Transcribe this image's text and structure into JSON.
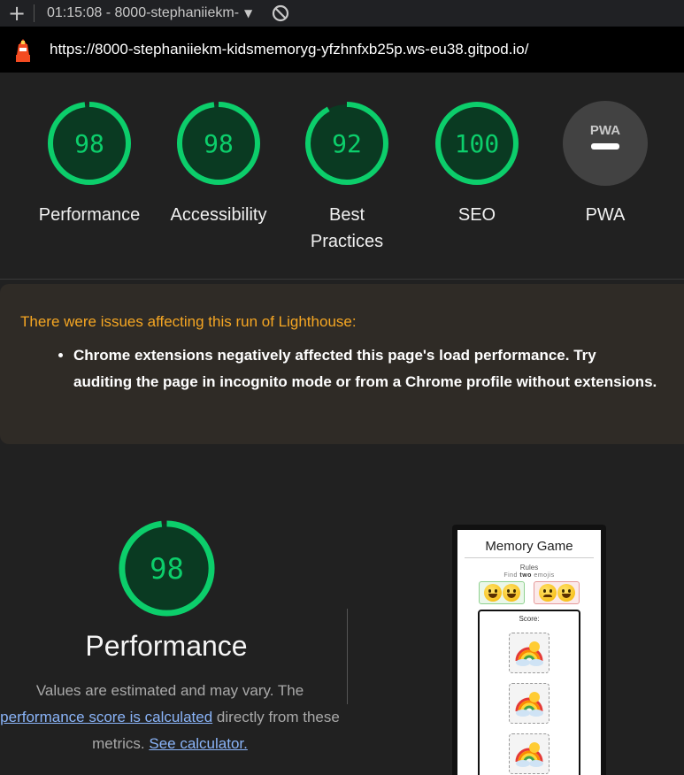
{
  "toolbar": {
    "new_tab_glyph": "+",
    "session_label": "01:15:08 - 8000-stephaniiekm-",
    "dropdown_icon": "caret-down-icon",
    "block_icon": "no-entry-icon"
  },
  "address": {
    "url": "https://8000-stephaniiekm-kidsmemoryg-yfzhnfxb25p.ws-eu38.gitpod.io/",
    "logo_icon": "lighthouse-icon"
  },
  "gauges": [
    {
      "score": "98",
      "label": "Performance",
      "fraction": 0.98
    },
    {
      "score": "98",
      "label": "Accessibility",
      "fraction": 0.98
    },
    {
      "score": "92",
      "label": "Best Practices",
      "fraction": 0.92
    },
    {
      "score": "100",
      "label": "SEO",
      "fraction": 1.0
    },
    {
      "score": "",
      "label": "PWA",
      "badge": "PWA"
    }
  ],
  "warning": {
    "title": "There were issues affecting this run of Lighthouse:",
    "items": [
      "Chrome extensions negatively affected this page's load performance. Try auditing the page in incognito mode or from a Chrome profile without extensions."
    ]
  },
  "performance": {
    "score": "98",
    "fraction": 0.98,
    "title": "Performance",
    "desc_prefix": "Values are estimated and may vary. The",
    "desc_link": "performance score is calculated",
    "desc_middle": "directly from these metrics.",
    "desc_link2": "See calculator."
  },
  "screenshot": {
    "title": "Memory Game",
    "rules": "Rules",
    "find_prefix": "Find",
    "find_bold": "two",
    "find_suffix": "emojis",
    "score_label": "Score:"
  },
  "colors": {
    "pass": "#0cce6b",
    "pass_bg": "#0a3a22",
    "warning_title": "#f5a623",
    "link": "#8ab4f8"
  }
}
